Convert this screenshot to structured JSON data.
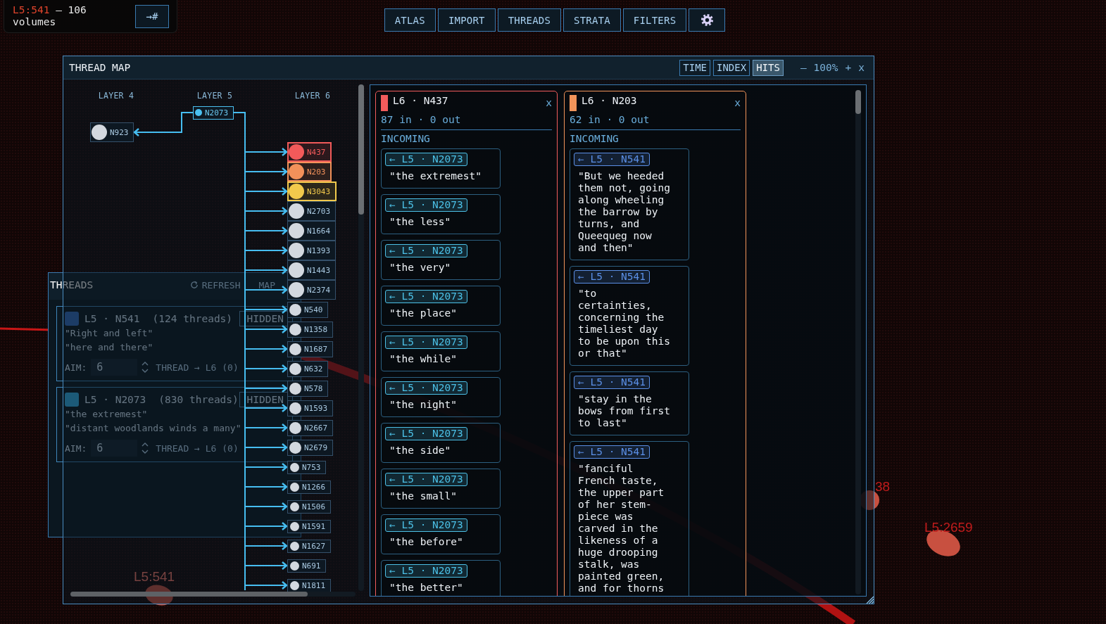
{
  "hud": {
    "location": "L5:541",
    "summary": "— 106 volumes",
    "jump_button": "→#"
  },
  "nav": [
    {
      "kind": "text",
      "label": "ATLAS"
    },
    {
      "kind": "text",
      "label": "IMPORT"
    },
    {
      "kind": "text",
      "label": "THREADS"
    },
    {
      "kind": "text",
      "label": "STRATA"
    },
    {
      "kind": "text",
      "label": "FILTERS"
    },
    {
      "kind": "settings"
    }
  ],
  "map": {
    "labels": [
      {
        "text": "L5:2659"
      },
      {
        "text": "38"
      },
      {
        "text": "L5:541"
      }
    ]
  },
  "threads_panel": {
    "title": "THREADS",
    "refresh": "REFRESH",
    "map": "MAP",
    "threads": [
      {
        "title": "L5 · N541",
        "count": "(124 threads)",
        "color": "#1d3c66",
        "badge": "HIDDEN",
        "quotes": [
          "\"Right and left\"",
          "\"here and there\""
        ],
        "aim_label": "AIM:",
        "aim_value": "6",
        "action": "THREAD → L6 (0)"
      },
      {
        "title": "L5 · N2073",
        "count": "(830 threads)",
        "color": "#1d5a78",
        "badge": "HIDDEN",
        "quotes": [
          "\"the extremest\"",
          "\"distant woodlands winds a many\""
        ],
        "aim_label": "AIM:",
        "aim_value": "6",
        "action": "THREAD → L6 (0)"
      }
    ]
  },
  "thread_map": {
    "title": "THREAD MAP",
    "sort_tabs": [
      {
        "label": "TIME",
        "selected": false
      },
      {
        "label": "INDEX",
        "selected": false
      },
      {
        "label": "HITS",
        "selected": true
      }
    ],
    "zoom_out": "–",
    "zoom": "100%",
    "zoom_in": "+",
    "close": "x",
    "graph": {
      "layers": [
        {
          "heading": "LAYER 4",
          "nodes": [
            {
              "kind": "plain",
              "label": "N923"
            }
          ]
        },
        {
          "heading": "LAYER 5",
          "nodes": [
            {
              "kind": "focus",
              "label": "N2073"
            }
          ]
        },
        {
          "heading": "LAYER 6",
          "nodes": [
            {
              "kind": "pinned",
              "label": "N437",
              "color": "#f25a5a"
            },
            {
              "kind": "pinned",
              "label": "N203",
              "color": "#f2915a"
            },
            {
              "kind": "pinned",
              "label": "N3043",
              "color": "#f2c94c"
            },
            {
              "kind": "plain",
              "label": "N2703"
            },
            {
              "kind": "plain",
              "label": "N1664"
            },
            {
              "kind": "plain",
              "label": "N1393"
            },
            {
              "kind": "plain",
              "label": "N1443"
            },
            {
              "kind": "plain",
              "label": "N2374"
            },
            {
              "kind": "minor",
              "label": "N540"
            },
            {
              "kind": "minor",
              "label": "N1358"
            },
            {
              "kind": "minor",
              "label": "N1687"
            },
            {
              "kind": "minor",
              "label": "N632"
            },
            {
              "kind": "minor",
              "label": "N578"
            },
            {
              "kind": "minor",
              "label": "N1593"
            },
            {
              "kind": "minor",
              "label": "N2667"
            },
            {
              "kind": "minor",
              "label": "N2679"
            },
            {
              "kind": "trace",
              "label": "N753"
            },
            {
              "kind": "trace",
              "label": "N1266"
            },
            {
              "kind": "trace",
              "label": "N1506"
            },
            {
              "kind": "trace",
              "label": "N1591"
            },
            {
              "kind": "trace",
              "label": "N1627"
            },
            {
              "kind": "trace",
              "label": "N691"
            },
            {
              "kind": "trace",
              "label": "N1811"
            }
          ]
        }
      ]
    },
    "details": {
      "cards": [
        {
          "title": "L6 · N437",
          "color": "#f25c5c",
          "close": "x",
          "stats": "87 in · 0 out",
          "section": "INCOMING",
          "items": [
            {
              "source": "← L5 · N2073",
              "color": "#4cc0e6",
              "quote": "\"the extremest\""
            },
            {
              "source": "← L5 · N2073",
              "color": "#4cc0e6",
              "quote": "\"the less\""
            },
            {
              "source": "← L5 · N2073",
              "color": "#4cc0e6",
              "quote": "\"the very\""
            },
            {
              "source": "← L5 · N2073",
              "color": "#4cc0e6",
              "quote": "\"the place\""
            },
            {
              "source": "← L5 · N2073",
              "color": "#4cc0e6",
              "quote": "\"the while\""
            },
            {
              "source": "← L5 · N2073",
              "color": "#4cc0e6",
              "quote": "\"the night\""
            },
            {
              "source": "← L5 · N2073",
              "color": "#4cc0e6",
              "quote": "\"the side\""
            },
            {
              "source": "← L5 · N2073",
              "color": "#4cc0e6",
              "quote": "\"the small\""
            },
            {
              "source": "← L5 · N2073",
              "color": "#4cc0e6",
              "quote": "\"the before\""
            },
            {
              "source": "← L5 · N2073",
              "color": "#4cc0e6",
              "quote": "\"the better\""
            }
          ]
        },
        {
          "title": "L6 · N203",
          "color": "#f2945a",
          "close": "x",
          "stats": "62 in · 0 out",
          "section": "INCOMING",
          "items": [
            {
              "source": "← L5 · N541",
              "color": "#5b8fe6",
              "quote": "\"But we heeded them not, going along wheeling the barrow by turns, and Queequeg now and then\""
            },
            {
              "source": "← L5 · N541",
              "color": "#5b8fe6",
              "quote": "\"to certainties, concerning the timeliest day to be upon this or that\""
            },
            {
              "source": "← L5 · N541",
              "color": "#5b8fe6",
              "quote": "\"stay in the bows from first to last\""
            },
            {
              "source": "← L5 · N541",
              "color": "#5b8fe6",
              "quote": "\"fanciful French taste, the upper part of her stem-piece was carved in the likeness of a huge drooping stalk, was painted green, and for thorns"
            }
          ]
        }
      ]
    }
  }
}
